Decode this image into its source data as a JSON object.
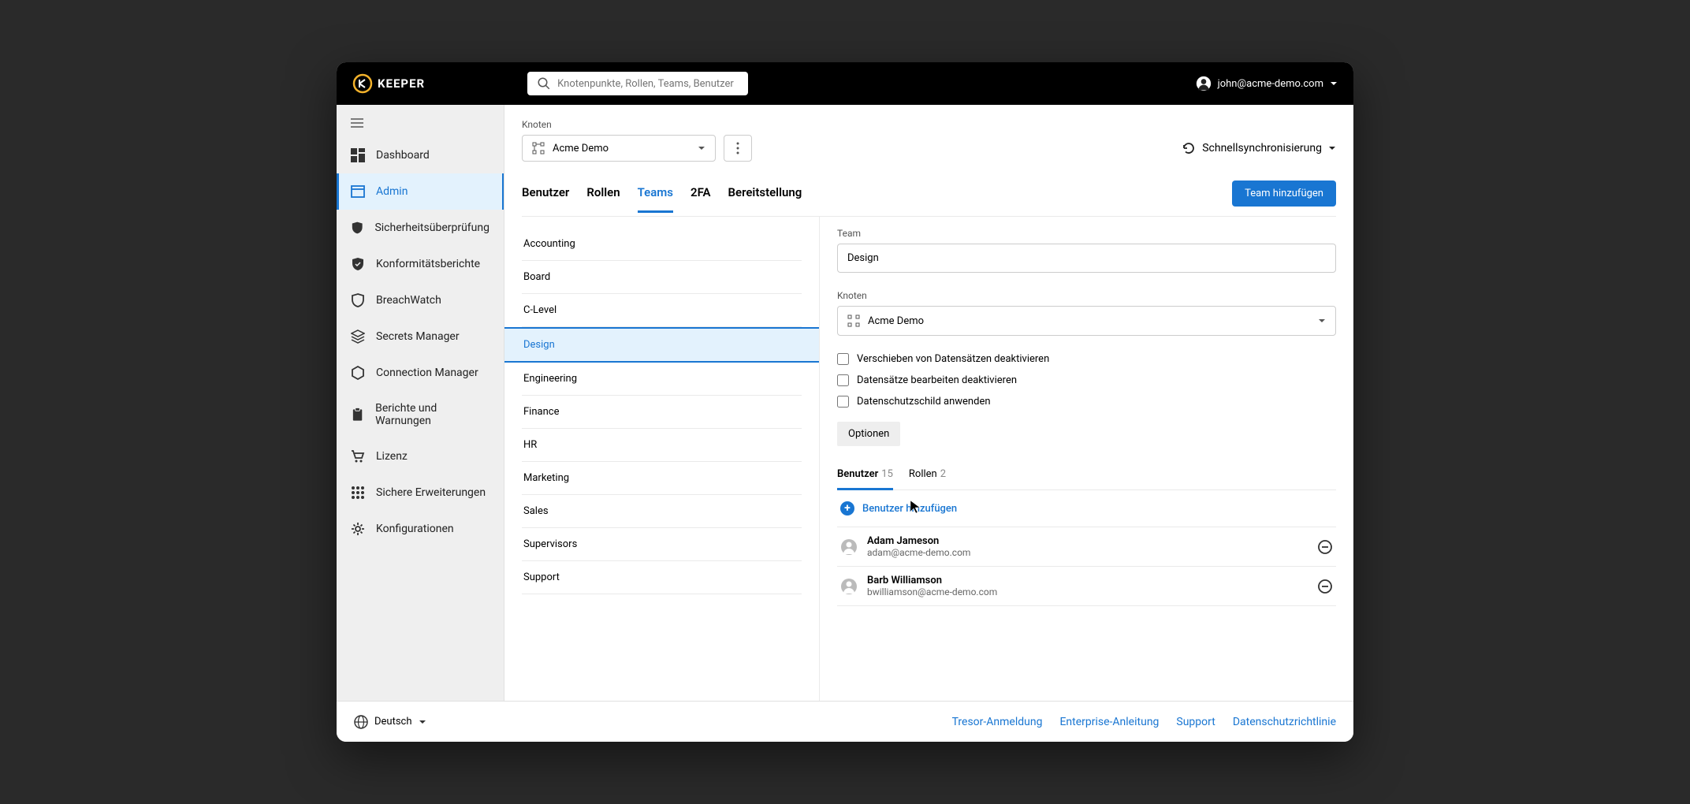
{
  "brand": {
    "name": "KEEPER"
  },
  "search": {
    "placeholder": "Knotenpunkte, Rollen, Teams, Benutzer"
  },
  "account": {
    "email": "john@acme-demo.com"
  },
  "sidebar": {
    "items": [
      {
        "label": "Dashboard",
        "icon": "dashboard-icon"
      },
      {
        "label": "Admin",
        "icon": "admin-icon"
      },
      {
        "label": "Sicherheitsüberprüfung",
        "icon": "shield-check-icon"
      },
      {
        "label": "Konformitätsberichte",
        "icon": "shield-solid-icon"
      },
      {
        "label": "BreachWatch",
        "icon": "shield-outline-icon"
      },
      {
        "label": "Secrets Manager",
        "icon": "layers-icon"
      },
      {
        "label": "Connection Manager",
        "icon": "hex-icon"
      },
      {
        "label": "Berichte und Warnungen",
        "icon": "clipboard-icon"
      },
      {
        "label": "Lizenz",
        "icon": "cart-icon"
      },
      {
        "label": "Sichere Erweiterungen",
        "icon": "grid-icon"
      },
      {
        "label": "Konfigurationen",
        "icon": "gear-icon"
      }
    ]
  },
  "header": {
    "node_label": "Knoten",
    "node_value": "Acme Demo",
    "quick_sync": "Schnellsynchronisierung",
    "tabs": [
      {
        "label": "Benutzer"
      },
      {
        "label": "Rollen"
      },
      {
        "label": "Teams"
      },
      {
        "label": "2FA"
      },
      {
        "label": "Bereitstellung"
      }
    ],
    "active_tab": "Teams",
    "add_team_label": "Team hinzufügen"
  },
  "teams": [
    "Accounting",
    "Board",
    "C-Level",
    "Design",
    "Engineering",
    "Finance",
    "HR",
    "Marketing",
    "Sales",
    "Supervisors",
    "Support"
  ],
  "selected_team": "Design",
  "detail": {
    "team_label": "Team",
    "team_value": "Design",
    "node_label": "Knoten",
    "node_value": "Acme Demo",
    "checkboxes": [
      "Verschieben von Datensätzen deaktivieren",
      "Datensätze bearbeiten deaktivieren",
      "Datenschutzschild anwenden"
    ],
    "options_label": "Optionen",
    "sub_tabs": [
      {
        "label": "Benutzer",
        "count": "15"
      },
      {
        "label": "Rollen",
        "count": "2"
      }
    ],
    "add_user_label": "Benutzer hinzufügen",
    "users": [
      {
        "name": "Adam Jameson",
        "email": "adam@acme-demo.com"
      },
      {
        "name": "Barb Williamson",
        "email": "bwilliamson@acme-demo.com"
      }
    ]
  },
  "footer": {
    "language": "Deutsch",
    "links": [
      "Tresor-Anmeldung",
      "Enterprise-Anleitung",
      "Support",
      "Datenschutzrichtlinie"
    ]
  },
  "colors": {
    "accent": "#1976d2",
    "brand_gold": "#f3b22b"
  }
}
